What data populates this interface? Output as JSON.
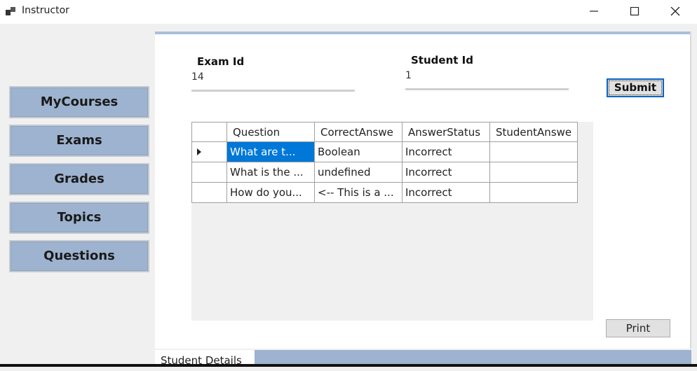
{
  "window": {
    "title": "Instructor"
  },
  "sidebar": {
    "items": [
      {
        "label": "MyCourses"
      },
      {
        "label": "Exams"
      },
      {
        "label": "Grades"
      },
      {
        "label": "Topics"
      },
      {
        "label": "Questions"
      }
    ]
  },
  "form": {
    "exam_id_label": "Exam Id",
    "exam_id_value": "14",
    "student_id_label": "Student Id",
    "student_id_value": "1",
    "submit_label": "Submit"
  },
  "grid": {
    "columns": [
      "Question",
      "CorrectAnswe",
      "AnswerStatus",
      "StudentAnswe"
    ],
    "rows": [
      {
        "question": "What are t...",
        "correct": "Boolean",
        "status": "Incorrect",
        "student": ""
      },
      {
        "question": "What is the ...",
        "correct": "undefined",
        "status": "Incorrect",
        "student": ""
      },
      {
        "question": "How do you...",
        "correct": "<-- This is a ...",
        "status": "Incorrect",
        "student": ""
      }
    ]
  },
  "print_label": "Print",
  "tabs": [
    {
      "label": "Student Details"
    }
  ],
  "colors": {
    "accent": "#9db3cf",
    "selection": "#0078d7"
  }
}
